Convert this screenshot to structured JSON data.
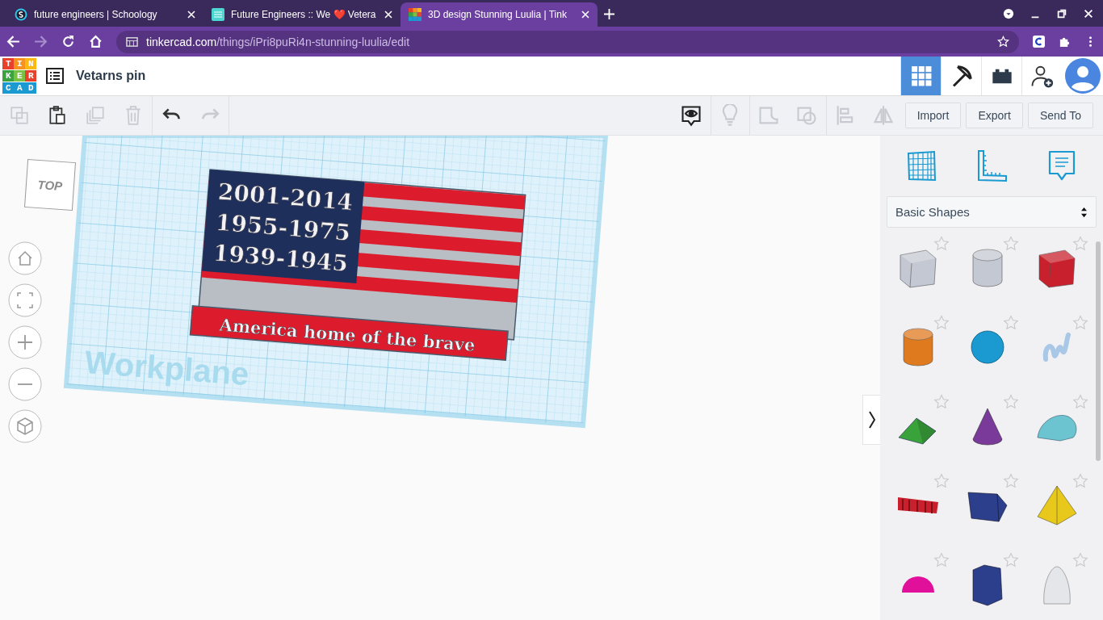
{
  "browser": {
    "tabs": [
      {
        "title": "future engineers | Schoology",
        "kind": "schoology",
        "selected": false
      },
      {
        "title": "Future Engineers :: We ❤️ Vetera",
        "kind": "fe",
        "selected": false
      },
      {
        "title": "3D design Stunning Luulia | Tink",
        "kind": "tinkercad",
        "selected": true
      }
    ],
    "url_host": "tinkercad.com",
    "url_path": "/things/iPri8puRi4n-stunning-luulia/edit",
    "forward_disabled": true
  },
  "app": {
    "logo_rows": [
      "TIN",
      "KER",
      "CAD"
    ],
    "design_title": "Vetarns pin",
    "view_buttons": [
      {
        "kind": "grid",
        "selected": true
      },
      {
        "kind": "pickaxe",
        "selected": false
      },
      {
        "kind": "bricks",
        "selected": false
      },
      {
        "kind": "add-user",
        "selected": false
      }
    ]
  },
  "toolbar": {
    "tools": [
      {
        "kind": "copy",
        "disabled": true
      },
      {
        "kind": "paste",
        "disabled": false
      },
      {
        "kind": "duplicate",
        "disabled": true
      },
      {
        "kind": "delete",
        "disabled": true
      },
      {
        "kind": "undo",
        "disabled": false
      },
      {
        "kind": "redo",
        "disabled": true
      }
    ],
    "view_tools": [
      {
        "kind": "eye",
        "disabled": false
      },
      {
        "kind": "bulb",
        "disabled": true
      },
      {
        "kind": "group",
        "disabled": true
      },
      {
        "kind": "ungroup",
        "disabled": true
      },
      {
        "kind": "align",
        "disabled": true
      },
      {
        "kind": "mirror",
        "disabled": true
      }
    ],
    "actions": [
      "Import",
      "Export",
      "Send To"
    ]
  },
  "canvas": {
    "view_cube": "TOP",
    "workplane_label": "Workplane",
    "model": {
      "years": [
        "2001-2014",
        "1955-1975",
        "1939-1945"
      ],
      "banner": "America home of the brave"
    }
  },
  "panel": {
    "category": "Basic Shapes",
    "shapes": [
      {
        "kind": "box",
        "color": "#c4c8d2"
      },
      {
        "kind": "cylinder",
        "color": "#c4c8d2"
      },
      {
        "kind": "box",
        "color": "#c8202c"
      },
      {
        "kind": "cylinder",
        "color": "#e07a1e"
      },
      {
        "kind": "sphere",
        "color": "#1a9ad0"
      },
      {
        "kind": "scribble",
        "color": "#a9c8e8"
      },
      {
        "kind": "roof",
        "color": "#3aa23a"
      },
      {
        "kind": "cone",
        "color": "#7a3a9a"
      },
      {
        "kind": "round-roof",
        "color": "#6cc4d0"
      },
      {
        "kind": "text",
        "color": "#c8202c"
      },
      {
        "kind": "prism",
        "color": "#2c3f8c"
      },
      {
        "kind": "pyramid",
        "color": "#e8c81a"
      },
      {
        "kind": "half-sphere",
        "color": "#e0109a"
      },
      {
        "kind": "polygon",
        "color": "#2c3f8c"
      },
      {
        "kind": "paraboloid",
        "color": "#e4e6ea"
      }
    ]
  }
}
